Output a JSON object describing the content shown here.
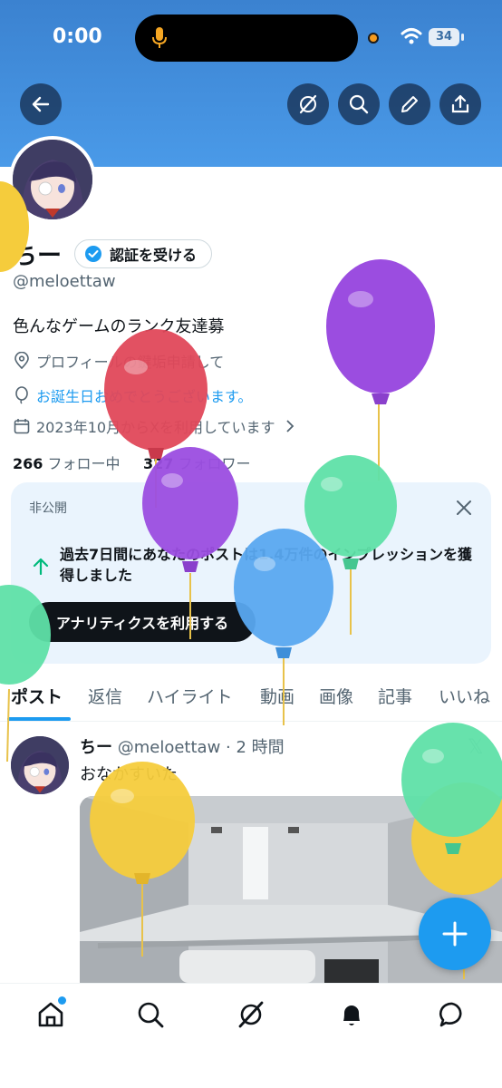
{
  "status_bar": {
    "time": "0:00",
    "battery": "34"
  },
  "header": {
    "back": "back-icon",
    "actions": [
      "grok-icon",
      "search-icon",
      "edit-icon",
      "share-icon"
    ]
  },
  "profile": {
    "name": "ちー",
    "verify_label": "認証を受ける",
    "handle": "@meloettaw",
    "bio": "色んなゲームのランク友達募",
    "location": "プロフィールの鍵垢申請して",
    "birthday": "お誕生日おめでとうございます。",
    "joined": "2023年10月からXを利用しています",
    "following_count": "266",
    "following_label": "フォロー中",
    "followers_count": "327",
    "followers_label": "フォロワー"
  },
  "private_card": {
    "label": "非公開",
    "message": "過去7日間にあなたのポストは1.4万件のインプレッションを獲得しました",
    "button": "アナリティクスを利用する"
  },
  "tabs": [
    "ポスト",
    "返信",
    "ハイライト",
    "動画",
    "画像",
    "記事",
    "いいね"
  ],
  "post": {
    "name": "ちー",
    "meta": "@meloettaw · 2 時間",
    "text": "おなかすいた"
  },
  "bottom_nav": [
    "home-icon",
    "search-icon",
    "grok-icon",
    "notifications-icon",
    "messages-icon"
  ],
  "colors": {
    "accent": "#1d9bf0",
    "banner": "#4a9ae8",
    "balloon_yellow": "#f5cc3c",
    "balloon_purple": "#9b4de0",
    "balloon_red": "#e0485a",
    "balloon_green": "#5fe0a8",
    "balloon_blue": "#5aa8f0"
  }
}
